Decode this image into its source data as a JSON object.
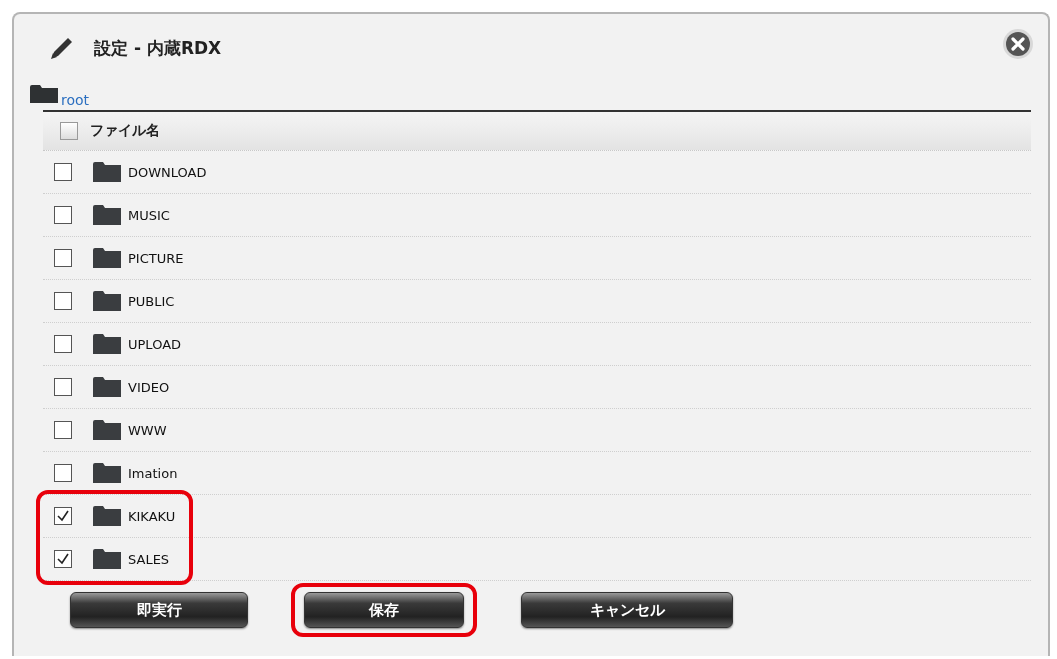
{
  "dialog": {
    "title": "設定 - 内蔵RDX",
    "path": "root"
  },
  "table": {
    "header": {
      "label": "ファイル名",
      "checked": false
    },
    "rows": [
      {
        "name": "DOWNLOAD",
        "checked": false,
        "highlighted": false
      },
      {
        "name": "MUSIC",
        "checked": false,
        "highlighted": false
      },
      {
        "name": "PICTURE",
        "checked": false,
        "highlighted": false
      },
      {
        "name": "PUBLIC",
        "checked": false,
        "highlighted": false
      },
      {
        "name": "UPLOAD",
        "checked": false,
        "highlighted": false
      },
      {
        "name": "VIDEO",
        "checked": false,
        "highlighted": false
      },
      {
        "name": "WWW",
        "checked": false,
        "highlighted": false
      },
      {
        "name": "Imation",
        "checked": false,
        "highlighted": false
      },
      {
        "name": "KIKAKU",
        "checked": true,
        "highlighted": true
      },
      {
        "name": "SALES",
        "checked": true,
        "highlighted": true
      }
    ]
  },
  "buttons": [
    {
      "label": "即実行",
      "highlighted": false
    },
    {
      "label": "保存",
      "highlighted": true
    },
    {
      "label": "キャンセル",
      "highlighted": false
    }
  ]
}
